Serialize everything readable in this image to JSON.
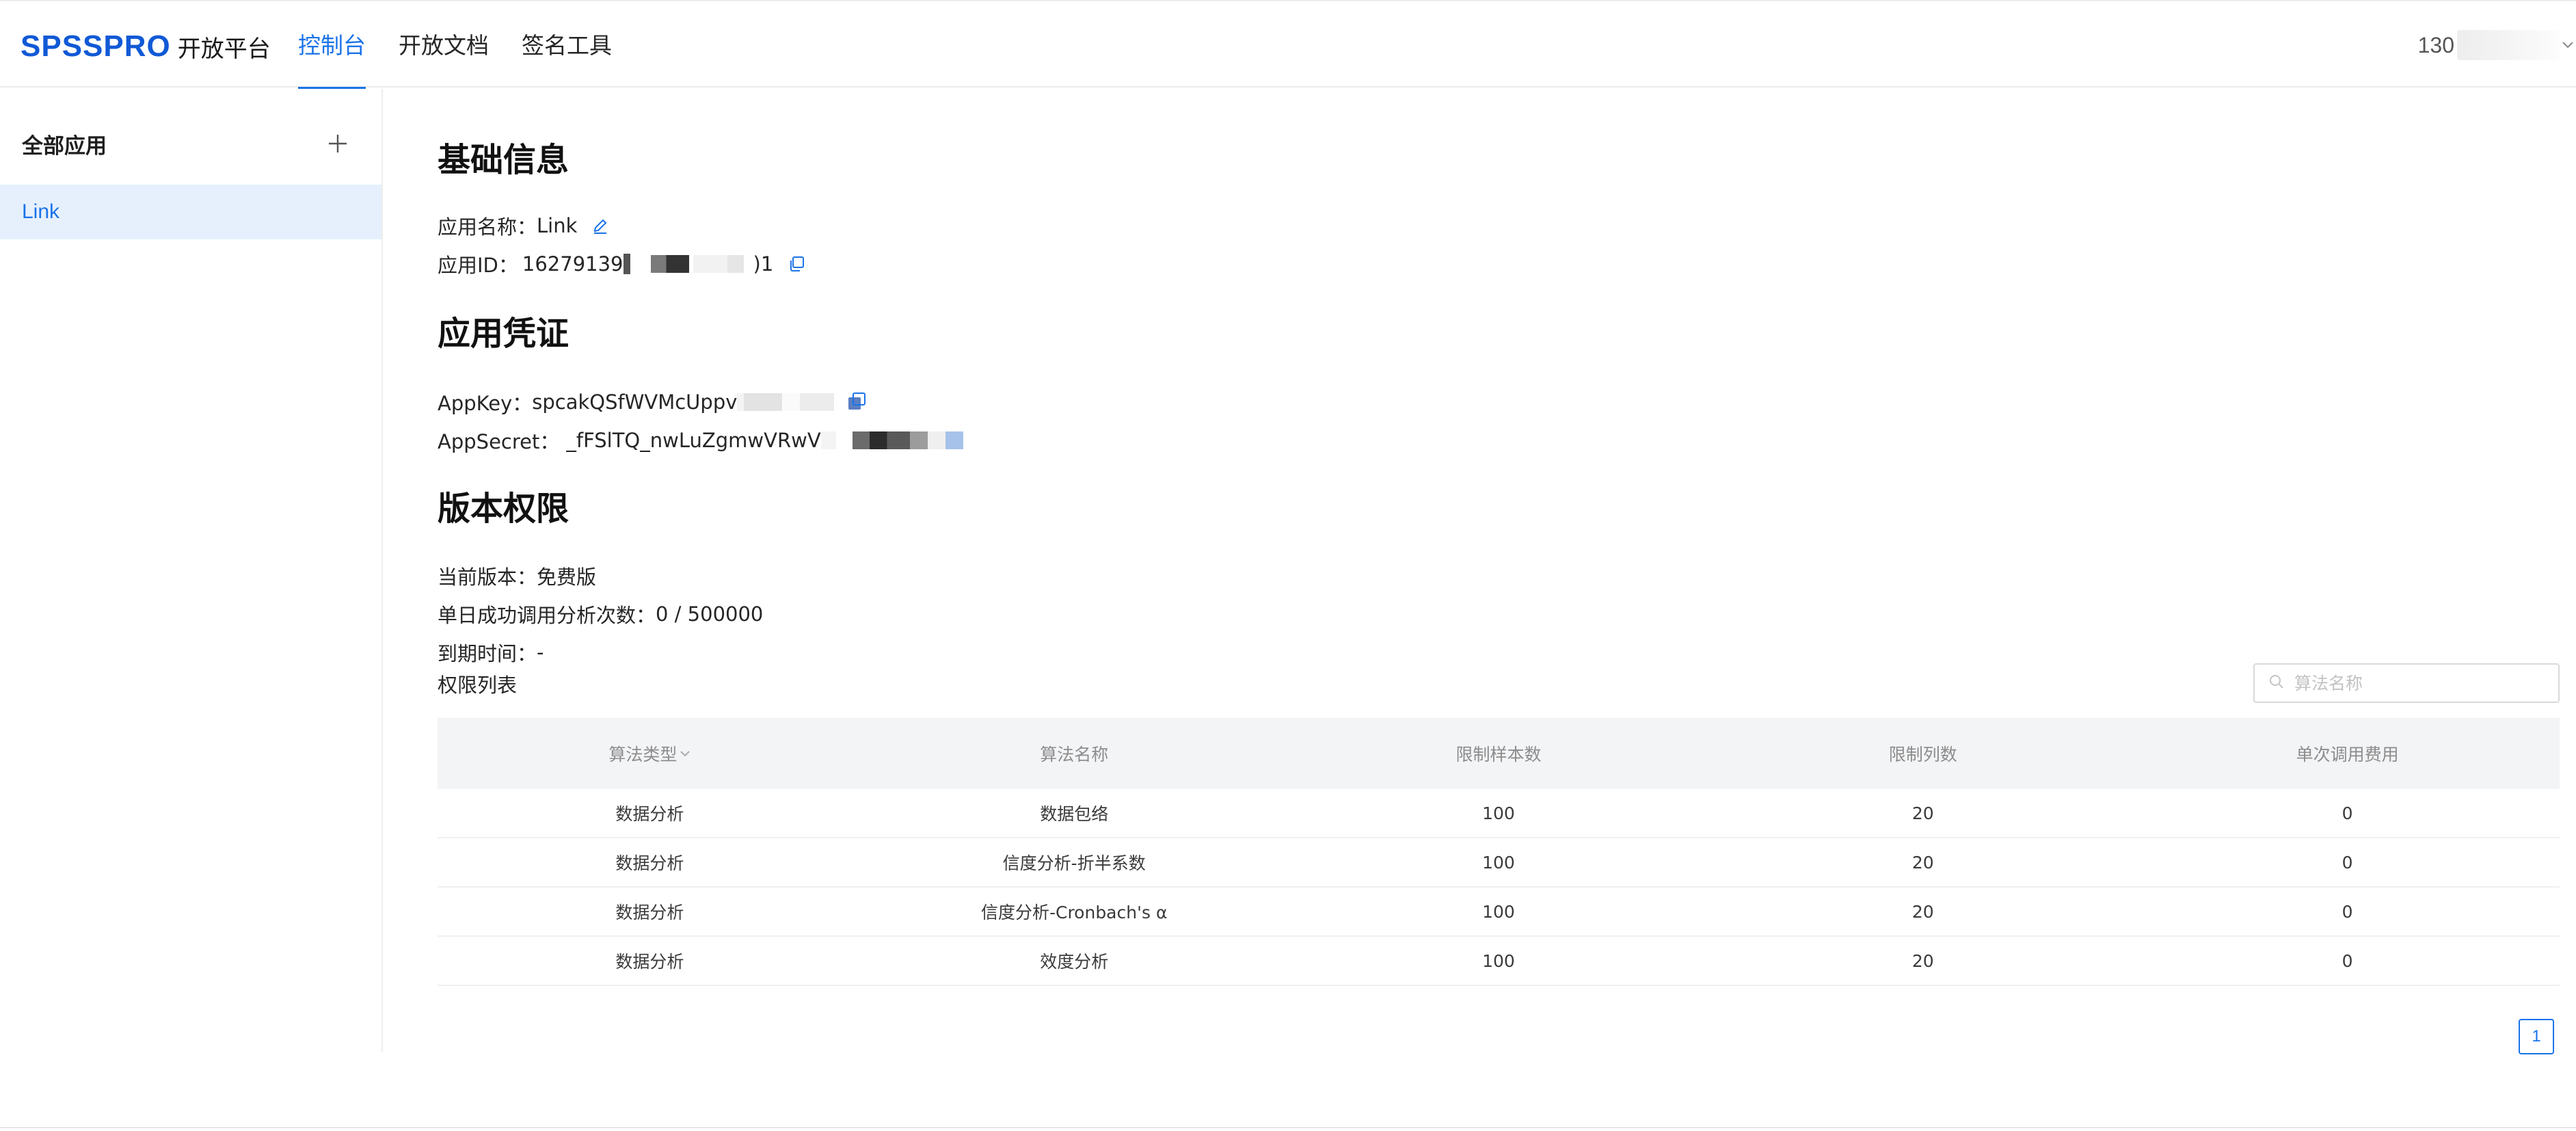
{
  "header": {
    "logo_text": "SPSSPRO",
    "logo_subtitle": "开放平台",
    "nav": [
      {
        "label": "控制台",
        "active": true
      },
      {
        "label": "开放文档",
        "active": false
      },
      {
        "label": "签名工具",
        "active": false
      }
    ],
    "user_phone_partial": "130"
  },
  "sidebar": {
    "title": "全部应用",
    "add_icon": "plus-icon",
    "apps": [
      {
        "label": "Link",
        "selected": true
      }
    ]
  },
  "basic_info": {
    "title": "基础信息",
    "app_name_label": "应用名称：",
    "app_name_value": "Link",
    "app_id_label": "应用ID：",
    "app_id_value_prefix": "16279139",
    "app_id_value_suffix": ")1",
    "edit_icon": "edit-pencil-icon",
    "copy_icon": "copy-icon"
  },
  "credentials": {
    "title": "应用凭证",
    "appkey_label": "AppKey：",
    "appkey_value": "spcakQSfWVMcUppv",
    "appsecret_label": "AppSecret：",
    "appsecret_value": "_fFSlTQ_nwLuZgmwVRwV"
  },
  "version": {
    "title": "版本权限",
    "current_label": "当前版本：",
    "current_value": "免费版",
    "daily_label": "单日成功调用分析次数：",
    "daily_value": "0 / 500000",
    "expiry_label": "到期时间：",
    "expiry_value": "-",
    "list_title": "权限列表",
    "search_placeholder": "算法名称"
  },
  "table": {
    "columns": [
      "算法类型",
      "算法名称",
      "限制样本数",
      "限制列数",
      "单次调用费用"
    ],
    "rows": [
      [
        "数据分析",
        "数据包络",
        "100",
        "20",
        "0"
      ],
      [
        "数据分析",
        "信度分析-折半系数",
        "100",
        "20",
        "0"
      ],
      [
        "数据分析",
        "信度分析-Cronbach's α",
        "100",
        "20",
        "0"
      ],
      [
        "数据分析",
        "效度分析",
        "100",
        "20",
        "0"
      ]
    ]
  },
  "pagination": {
    "current_page": "1"
  },
  "colors": {
    "accent": "#1a73e8",
    "logo": "#1159d6",
    "selected_bg": "#e6f0fd",
    "table_header_bg": "#f3f4f6"
  }
}
